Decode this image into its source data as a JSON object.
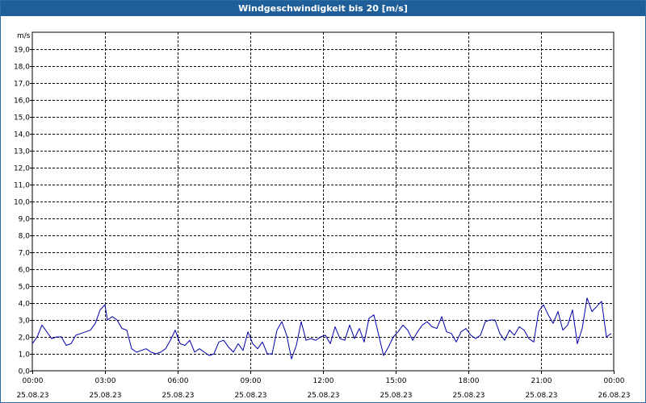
{
  "window": {
    "title": "Windgeschwindigkeit bis 20 [m/s]"
  },
  "chart_data": {
    "type": "line",
    "title": "Windgeschwindigkeit bis 20 [m/s]",
    "ylabel": "m/s",
    "xlabel": "",
    "ylim": [
      0,
      20
    ],
    "xlim": [
      0,
      24
    ],
    "grid": true,
    "line_color": "#0000aa",
    "y_ticks": [
      "0,0",
      "1,0",
      "2,0",
      "3,0",
      "4,0",
      "5,0",
      "6,0",
      "7,0",
      "8,0",
      "9,0",
      "10,0",
      "11,0",
      "12,0",
      "13,0",
      "14,0",
      "15,0",
      "16,0",
      "17,0",
      "18,0",
      "19,0"
    ],
    "x_ticks": [
      {
        "time": "00:00",
        "date": "25.08.23"
      },
      {
        "time": "03:00",
        "date": "25.08.23"
      },
      {
        "time": "06:00",
        "date": "25.08.23"
      },
      {
        "time": "09:00",
        "date": "25.08.23"
      },
      {
        "time": "12:00",
        "date": "25.08.23"
      },
      {
        "time": "15:00",
        "date": "25.08.23"
      },
      {
        "time": "18:00",
        "date": "25.08.23"
      },
      {
        "time": "21:00",
        "date": "25.08.23"
      },
      {
        "time": "00:00",
        "date": "26.08.23"
      }
    ],
    "x_unit": "hours since 00:00 25.08.23",
    "series": [
      {
        "values": [
          [
            0.0,
            1.6
          ],
          [
            0.2,
            2.0
          ],
          [
            0.4,
            2.7
          ],
          [
            0.6,
            2.3
          ],
          [
            0.8,
            1.9
          ],
          [
            1.0,
            2.0
          ],
          [
            1.2,
            2.0
          ],
          [
            1.4,
            1.5
          ],
          [
            1.6,
            1.6
          ],
          [
            1.8,
            2.1
          ],
          [
            2.0,
            2.2
          ],
          [
            2.2,
            2.3
          ],
          [
            2.4,
            2.4
          ],
          [
            2.6,
            2.8
          ],
          [
            2.8,
            3.6
          ],
          [
            3.0,
            3.9
          ],
          [
            3.1,
            3.0
          ],
          [
            3.3,
            3.2
          ],
          [
            3.5,
            3.0
          ],
          [
            3.7,
            2.5
          ],
          [
            3.9,
            2.4
          ],
          [
            4.1,
            1.3
          ],
          [
            4.3,
            1.1
          ],
          [
            4.5,
            1.2
          ],
          [
            4.7,
            1.3
          ],
          [
            4.9,
            1.1
          ],
          [
            5.1,
            1.0
          ],
          [
            5.3,
            1.1
          ],
          [
            5.5,
            1.3
          ],
          [
            5.7,
            1.8
          ],
          [
            5.9,
            2.4
          ],
          [
            6.1,
            1.6
          ],
          [
            6.3,
            1.5
          ],
          [
            6.5,
            1.8
          ],
          [
            6.7,
            1.1
          ],
          [
            6.9,
            1.3
          ],
          [
            7.1,
            1.1
          ],
          [
            7.3,
            0.9
          ],
          [
            7.5,
            1.0
          ],
          [
            7.7,
            1.7
          ],
          [
            7.9,
            1.8
          ],
          [
            8.1,
            1.4
          ],
          [
            8.3,
            1.1
          ],
          [
            8.5,
            1.6
          ],
          [
            8.7,
            1.2
          ],
          [
            8.9,
            2.3
          ],
          [
            9.1,
            1.6
          ],
          [
            9.3,
            1.3
          ],
          [
            9.5,
            1.7
          ],
          [
            9.7,
            1.0
          ],
          [
            9.9,
            1.0
          ],
          [
            10.1,
            2.4
          ],
          [
            10.3,
            2.9
          ],
          [
            10.5,
            2.1
          ],
          [
            10.7,
            0.7
          ],
          [
            10.9,
            1.5
          ],
          [
            11.1,
            2.9
          ],
          [
            11.3,
            1.8
          ],
          [
            11.5,
            1.9
          ],
          [
            11.7,
            1.8
          ],
          [
            11.9,
            2.0
          ],
          [
            12.1,
            2.1
          ],
          [
            12.3,
            1.6
          ],
          [
            12.5,
            2.6
          ],
          [
            12.7,
            1.9
          ],
          [
            12.9,
            1.8
          ],
          [
            13.1,
            2.7
          ],
          [
            13.3,
            1.9
          ],
          [
            13.5,
            2.5
          ],
          [
            13.7,
            1.7
          ],
          [
            13.9,
            3.1
          ],
          [
            14.1,
            3.3
          ],
          [
            14.3,
            2.1
          ],
          [
            14.5,
            0.9
          ],
          [
            14.7,
            1.4
          ],
          [
            14.9,
            2.0
          ],
          [
            15.1,
            2.3
          ],
          [
            15.3,
            2.7
          ],
          [
            15.5,
            2.4
          ],
          [
            15.7,
            1.8
          ],
          [
            15.9,
            2.3
          ],
          [
            16.1,
            2.7
          ],
          [
            16.3,
            2.9
          ],
          [
            16.5,
            2.6
          ],
          [
            16.7,
            2.5
          ],
          [
            16.9,
            3.2
          ],
          [
            17.1,
            2.3
          ],
          [
            17.3,
            2.2
          ],
          [
            17.5,
            1.7
          ],
          [
            17.7,
            2.3
          ],
          [
            17.9,
            2.5
          ],
          [
            18.1,
            2.1
          ],
          [
            18.3,
            1.9
          ],
          [
            18.5,
            2.1
          ],
          [
            18.7,
            2.9
          ],
          [
            18.9,
            3.0
          ],
          [
            19.1,
            3.0
          ],
          [
            19.3,
            2.2
          ],
          [
            19.5,
            1.8
          ],
          [
            19.7,
            2.4
          ],
          [
            19.9,
            2.1
          ],
          [
            20.1,
            2.6
          ],
          [
            20.3,
            2.4
          ],
          [
            20.5,
            1.9
          ],
          [
            20.7,
            1.7
          ],
          [
            20.9,
            3.5
          ],
          [
            21.1,
            3.9
          ],
          [
            21.3,
            3.3
          ],
          [
            21.5,
            2.8
          ],
          [
            21.7,
            3.5
          ],
          [
            21.9,
            2.4
          ],
          [
            22.1,
            2.7
          ],
          [
            22.3,
            3.6
          ],
          [
            22.5,
            1.6
          ],
          [
            22.7,
            2.5
          ],
          [
            22.9,
            4.3
          ],
          [
            23.1,
            3.5
          ],
          [
            23.3,
            3.8
          ],
          [
            23.5,
            4.1
          ],
          [
            23.7,
            2.0
          ],
          [
            23.9,
            2.2
          ]
        ]
      }
    ]
  }
}
